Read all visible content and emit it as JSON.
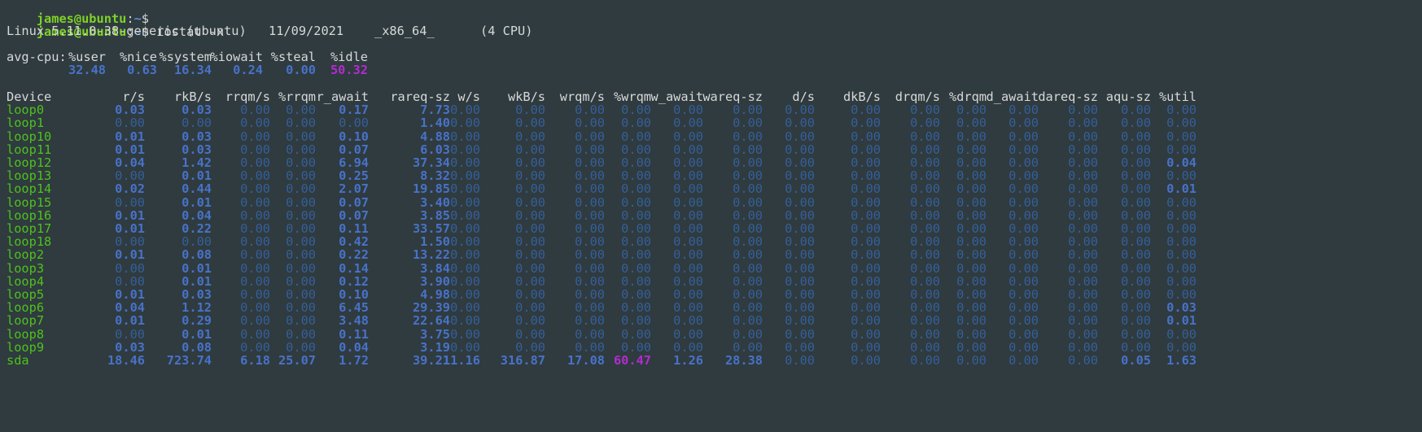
{
  "prompt": {
    "user": "james@ubuntu",
    "sep": ":",
    "path": "~",
    "symbol": "$"
  },
  "command": "iostat -x",
  "sysinfo": {
    "kernel": "Linux 5.11.0-38-generic (ubuntu)",
    "date": "11/09/2021",
    "arch": "_x86_64_",
    "cpu": "(4 CPU)"
  },
  "avgcpu": {
    "label": "avg-cpu:",
    "headers": [
      "%user",
      "%nice",
      "%system",
      "%iowait",
      "%steal",
      "%idle"
    ],
    "values": [
      "32.48",
      "0.63",
      "16.34",
      "0.24",
      "0.00",
      "50.32"
    ]
  },
  "table": {
    "columns": [
      "Device",
      "r/s",
      "rkB/s",
      "rrqm/s",
      "%rrqm",
      "r_await",
      "rareq-sz",
      "w/s",
      "wkB/s",
      "wrqm/s",
      "%wrqm",
      "w_await",
      "wareq-sz",
      "d/s",
      "dkB/s",
      "drqm/s",
      "%drqm",
      "d_await",
      "dareq-sz",
      "aqu-sz",
      "%util"
    ],
    "rows": [
      {
        "device": "loop0",
        "values": [
          "0.03",
          "0.03",
          "0.00",
          "0.00",
          "0.17",
          "7.73",
          "0.00",
          "0.00",
          "0.00",
          "0.00",
          "0.00",
          "0.00",
          "0.00",
          "0.00",
          "0.00",
          "0.00",
          "0.00",
          "0.00",
          "0.00",
          "0.00"
        ]
      },
      {
        "device": "loop1",
        "values": [
          "0.00",
          "0.00",
          "0.00",
          "0.00",
          "0.00",
          "1.40",
          "0.00",
          "0.00",
          "0.00",
          "0.00",
          "0.00",
          "0.00",
          "0.00",
          "0.00",
          "0.00",
          "0.00",
          "0.00",
          "0.00",
          "0.00",
          "0.00"
        ]
      },
      {
        "device": "loop10",
        "values": [
          "0.01",
          "0.03",
          "0.00",
          "0.00",
          "0.10",
          "4.88",
          "0.00",
          "0.00",
          "0.00",
          "0.00",
          "0.00",
          "0.00",
          "0.00",
          "0.00",
          "0.00",
          "0.00",
          "0.00",
          "0.00",
          "0.00",
          "0.00"
        ]
      },
      {
        "device": "loop11",
        "values": [
          "0.01",
          "0.03",
          "0.00",
          "0.00",
          "0.07",
          "6.03",
          "0.00",
          "0.00",
          "0.00",
          "0.00",
          "0.00",
          "0.00",
          "0.00",
          "0.00",
          "0.00",
          "0.00",
          "0.00",
          "0.00",
          "0.00",
          "0.00"
        ]
      },
      {
        "device": "loop12",
        "values": [
          "0.04",
          "1.42",
          "0.00",
          "0.00",
          "6.94",
          "37.34",
          "0.00",
          "0.00",
          "0.00",
          "0.00",
          "0.00",
          "0.00",
          "0.00",
          "0.00",
          "0.00",
          "0.00",
          "0.00",
          "0.00",
          "0.00",
          "0.04"
        ]
      },
      {
        "device": "loop13",
        "values": [
          "0.00",
          "0.01",
          "0.00",
          "0.00",
          "0.25",
          "8.32",
          "0.00",
          "0.00",
          "0.00",
          "0.00",
          "0.00",
          "0.00",
          "0.00",
          "0.00",
          "0.00",
          "0.00",
          "0.00",
          "0.00",
          "0.00",
          "0.00"
        ]
      },
      {
        "device": "loop14",
        "values": [
          "0.02",
          "0.44",
          "0.00",
          "0.00",
          "2.07",
          "19.85",
          "0.00",
          "0.00",
          "0.00",
          "0.00",
          "0.00",
          "0.00",
          "0.00",
          "0.00",
          "0.00",
          "0.00",
          "0.00",
          "0.00",
          "0.00",
          "0.01"
        ]
      },
      {
        "device": "loop15",
        "values": [
          "0.00",
          "0.01",
          "0.00",
          "0.00",
          "0.07",
          "3.40",
          "0.00",
          "0.00",
          "0.00",
          "0.00",
          "0.00",
          "0.00",
          "0.00",
          "0.00",
          "0.00",
          "0.00",
          "0.00",
          "0.00",
          "0.00",
          "0.00"
        ]
      },
      {
        "device": "loop16",
        "values": [
          "0.01",
          "0.04",
          "0.00",
          "0.00",
          "0.07",
          "3.85",
          "0.00",
          "0.00",
          "0.00",
          "0.00",
          "0.00",
          "0.00",
          "0.00",
          "0.00",
          "0.00",
          "0.00",
          "0.00",
          "0.00",
          "0.00",
          "0.00"
        ]
      },
      {
        "device": "loop17",
        "values": [
          "0.01",
          "0.22",
          "0.00",
          "0.00",
          "0.11",
          "33.57",
          "0.00",
          "0.00",
          "0.00",
          "0.00",
          "0.00",
          "0.00",
          "0.00",
          "0.00",
          "0.00",
          "0.00",
          "0.00",
          "0.00",
          "0.00",
          "0.00"
        ]
      },
      {
        "device": "loop18",
        "values": [
          "0.00",
          "0.00",
          "0.00",
          "0.00",
          "0.42",
          "1.50",
          "0.00",
          "0.00",
          "0.00",
          "0.00",
          "0.00",
          "0.00",
          "0.00",
          "0.00",
          "0.00",
          "0.00",
          "0.00",
          "0.00",
          "0.00",
          "0.00"
        ]
      },
      {
        "device": "loop2",
        "values": [
          "0.01",
          "0.08",
          "0.00",
          "0.00",
          "0.22",
          "13.22",
          "0.00",
          "0.00",
          "0.00",
          "0.00",
          "0.00",
          "0.00",
          "0.00",
          "0.00",
          "0.00",
          "0.00",
          "0.00",
          "0.00",
          "0.00",
          "0.00"
        ]
      },
      {
        "device": "loop3",
        "values": [
          "0.00",
          "0.01",
          "0.00",
          "0.00",
          "0.14",
          "3.84",
          "0.00",
          "0.00",
          "0.00",
          "0.00",
          "0.00",
          "0.00",
          "0.00",
          "0.00",
          "0.00",
          "0.00",
          "0.00",
          "0.00",
          "0.00",
          "0.00"
        ]
      },
      {
        "device": "loop4",
        "values": [
          "0.00",
          "0.01",
          "0.00",
          "0.00",
          "0.12",
          "3.90",
          "0.00",
          "0.00",
          "0.00",
          "0.00",
          "0.00",
          "0.00",
          "0.00",
          "0.00",
          "0.00",
          "0.00",
          "0.00",
          "0.00",
          "0.00",
          "0.00"
        ]
      },
      {
        "device": "loop5",
        "values": [
          "0.01",
          "0.03",
          "0.00",
          "0.00",
          "0.10",
          "4.98",
          "0.00",
          "0.00",
          "0.00",
          "0.00",
          "0.00",
          "0.00",
          "0.00",
          "0.00",
          "0.00",
          "0.00",
          "0.00",
          "0.00",
          "0.00",
          "0.00"
        ]
      },
      {
        "device": "loop6",
        "values": [
          "0.04",
          "1.12",
          "0.00",
          "0.00",
          "6.45",
          "29.39",
          "0.00",
          "0.00",
          "0.00",
          "0.00",
          "0.00",
          "0.00",
          "0.00",
          "0.00",
          "0.00",
          "0.00",
          "0.00",
          "0.00",
          "0.00",
          "0.03"
        ]
      },
      {
        "device": "loop7",
        "values": [
          "0.01",
          "0.29",
          "0.00",
          "0.00",
          "3.48",
          "22.64",
          "0.00",
          "0.00",
          "0.00",
          "0.00",
          "0.00",
          "0.00",
          "0.00",
          "0.00",
          "0.00",
          "0.00",
          "0.00",
          "0.00",
          "0.00",
          "0.01"
        ]
      },
      {
        "device": "loop8",
        "values": [
          "0.00",
          "0.01",
          "0.00",
          "0.00",
          "0.11",
          "3.75",
          "0.00",
          "0.00",
          "0.00",
          "0.00",
          "0.00",
          "0.00",
          "0.00",
          "0.00",
          "0.00",
          "0.00",
          "0.00",
          "0.00",
          "0.00",
          "0.00"
        ]
      },
      {
        "device": "loop9",
        "values": [
          "0.03",
          "0.08",
          "0.00",
          "0.00",
          "0.04",
          "3.19",
          "0.00",
          "0.00",
          "0.00",
          "0.00",
          "0.00",
          "0.00",
          "0.00",
          "0.00",
          "0.00",
          "0.00",
          "0.00",
          "0.00",
          "0.00",
          "0.00"
        ]
      },
      {
        "device": "sda",
        "values": [
          "18.46",
          "723.74",
          "6.18",
          "25.07",
          "1.72",
          "39.21",
          "11.16",
          "316.87",
          "17.08",
          "60.47",
          "1.26",
          "28.38",
          "0.00",
          "0.00",
          "0.00",
          "0.00",
          "0.00",
          "0.00",
          "0.05",
          "1.63"
        ]
      }
    ]
  },
  "colors": {
    "background": "#2f3b3f",
    "prompt_user": "#7fd128",
    "device": "#4fc11c",
    "value": "#3f6fbf",
    "highlight": "#b22bd0",
    "text": "#d8d8d8"
  }
}
